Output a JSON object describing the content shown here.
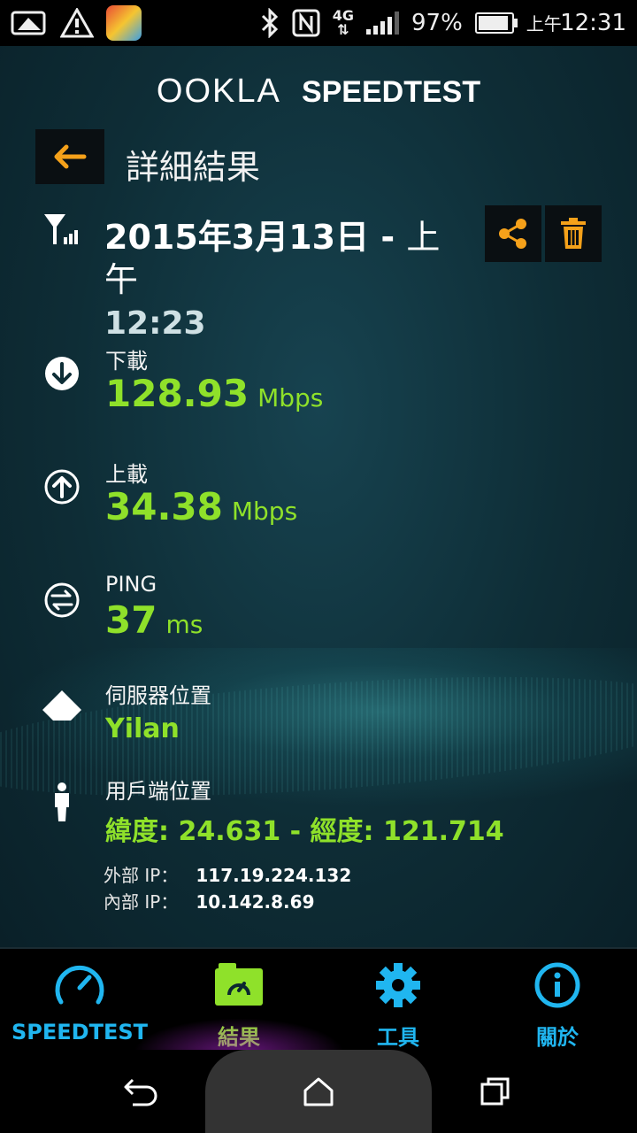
{
  "status_bar": {
    "battery": "97%",
    "battery_level": 0.97,
    "time_prefix": "上午",
    "time": "12:31",
    "network": "4G",
    "icons": [
      "image-icon",
      "warning-icon",
      "line-game-app-icon",
      "bluetooth-icon",
      "nfc-icon",
      "4g-data-icon",
      "signal-icon",
      "battery-icon"
    ]
  },
  "brand": {
    "ookla": "OOKLA",
    "speedtest": "SPEEDTEST"
  },
  "header": {
    "title": "詳細結果"
  },
  "result": {
    "date": "2015年3月13日",
    "separator": "-",
    "ampm": "上午",
    "time": "12:23",
    "download": {
      "label": "下載",
      "value": "128.93",
      "unit": "Mbps"
    },
    "upload": {
      "label": "上載",
      "value": "34.38",
      "unit": "Mbps"
    },
    "ping": {
      "label": "PING",
      "value": "37",
      "unit": "ms"
    },
    "server": {
      "label": "伺服器位置",
      "value": "Yilan"
    },
    "client": {
      "label": "用戶端位置",
      "value": "緯度: 24.631 - 經度: 121.714"
    },
    "external_ip": {
      "label": "外部 IP：",
      "value": "117.19.224.132"
    },
    "internal_ip": {
      "label": "內部 IP：",
      "value": "10.142.8.69"
    }
  },
  "nav": [
    {
      "label": "SPEEDTEST",
      "icon": "speedometer-icon"
    },
    {
      "label": "結果",
      "icon": "results-folder-icon"
    },
    {
      "label": "工具",
      "icon": "gear-icon"
    },
    {
      "label": "關於",
      "icon": "info-icon"
    }
  ],
  "colors": {
    "accent_green": "#8fe12a",
    "accent_blue": "#20b6f0",
    "accent_orange": "#f5a11a",
    "background": "#0e2d36"
  }
}
